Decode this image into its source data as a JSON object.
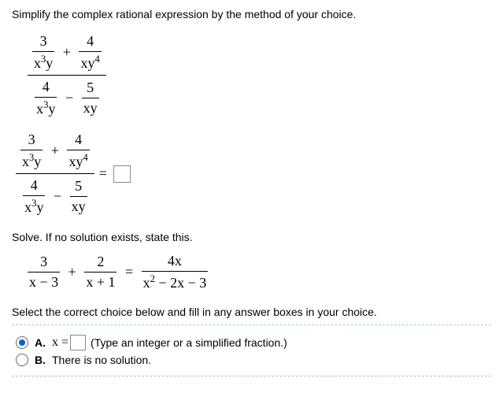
{
  "q1": {
    "instruction": "Simplify the complex rational expression by the method of your choice.",
    "num_frac1_top": "3",
    "num_frac1_bot_base1": "x",
    "num_frac1_bot_exp1": "3",
    "num_frac1_bot_base2": "y",
    "num_op": "+",
    "num_frac2_top": "4",
    "num_frac2_bot_base1": "xy",
    "num_frac2_bot_exp1": "4",
    "den_frac1_top": "4",
    "den_frac1_bot_base1": "x",
    "den_frac1_bot_exp1": "3",
    "den_frac1_bot_base2": "y",
    "den_op": "−",
    "den_frac2_top": "5",
    "den_frac2_bot": "xy",
    "equals": "="
  },
  "q2": {
    "instruction": "Solve. If no solution exists, state this.",
    "t1_top": "3",
    "t1_bot": "x − 3",
    "op1": "+",
    "t2_top": "2",
    "t2_bot": "x + 1",
    "eq": "=",
    "t3_top": "4x",
    "t3_bot_a": "x",
    "t3_bot_exp": "2",
    "t3_bot_b": " − 2x − 3",
    "select": "Select the correct choice below and fill in any answer boxes in your choice.",
    "choiceA_label": "A.",
    "choiceA_text": "x =",
    "choiceA_hint": "(Type an integer or a simplified fraction.)",
    "choiceB_label": "B.",
    "choiceB_text": "There is no solution."
  }
}
